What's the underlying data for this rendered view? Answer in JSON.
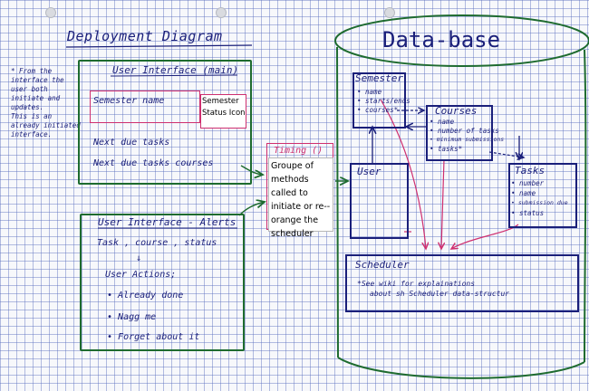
{
  "title": "Deployment Diagram",
  "database": {
    "title": "Data-base"
  },
  "note": {
    "lines": [
      "* From the",
      "interface the",
      "user both",
      "initiate and",
      "updates.",
      "This is an",
      "already initiated",
      "interface."
    ]
  },
  "ui_main": {
    "title": "User Interface (main)",
    "semester_name": "Semester name",
    "status_icon": "Semester Status Icon",
    "next_due_tasks": "Next due tasks",
    "next_due_tasks_courses": "Next due tasks courses"
  },
  "ui_alerts": {
    "title": "User Interface - Alerts",
    "line1": "Task , course , status",
    "actions_title": "User Actions;",
    "actions": [
      "Already done",
      "Nagg me",
      "Forget about it"
    ]
  },
  "timing": {
    "title": "Timing ()",
    "description": "Groupe of methods called to initiate or re-- orange the scheduler"
  },
  "semester": {
    "title": "Semester",
    "fields": [
      "name",
      "starts/ends",
      "courses*"
    ]
  },
  "courses": {
    "title": "Courses",
    "fields": [
      "name",
      "number of tasks",
      "minimum submissions",
      "tasks*"
    ]
  },
  "user": {
    "title": "User"
  },
  "tasks": {
    "title": "Tasks",
    "fields": [
      "number",
      "name",
      "submission due",
      "status"
    ]
  },
  "scheduler": {
    "title": "Scheduler",
    "note_lines": [
      "*See wiki for explainations",
      "about sh Scheduler data-structur"
    ]
  }
}
